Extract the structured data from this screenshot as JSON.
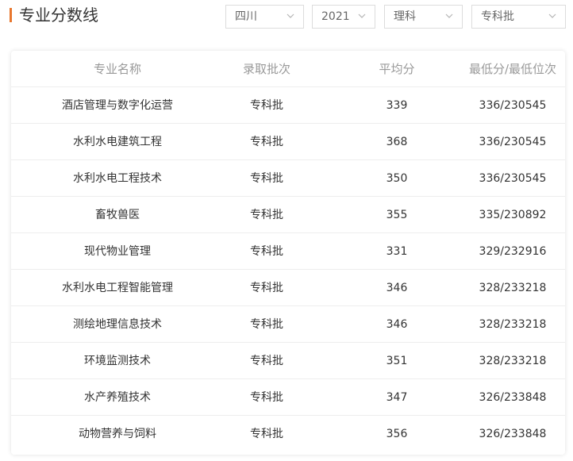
{
  "header": {
    "title": "专业分数线",
    "accent_color": "#e8772e"
  },
  "filters": {
    "province": "四川",
    "year": "2021",
    "subject": "理科",
    "batch": "专科批",
    "chevron_icon": "chevron-down-icon"
  },
  "table": {
    "columns": [
      "专业名称",
      "录取批次",
      "平均分",
      "最低分/最低位次"
    ],
    "rows": [
      {
        "major": "酒店管理与数字化运营",
        "batch": "专科批",
        "avg": "339",
        "min": "336/230545"
      },
      {
        "major": "水利水电建筑工程",
        "batch": "专科批",
        "avg": "368",
        "min": "336/230545"
      },
      {
        "major": "水利水电工程技术",
        "batch": "专科批",
        "avg": "350",
        "min": "336/230545"
      },
      {
        "major": "畜牧兽医",
        "batch": "专科批",
        "avg": "355",
        "min": "335/230892"
      },
      {
        "major": "现代物业管理",
        "batch": "专科批",
        "avg": "331",
        "min": "329/232916"
      },
      {
        "major": "水利水电工程智能管理",
        "batch": "专科批",
        "avg": "346",
        "min": "328/233218"
      },
      {
        "major": "测绘地理信息技术",
        "batch": "专科批",
        "avg": "346",
        "min": "328/233218"
      },
      {
        "major": "环境监测技术",
        "batch": "专科批",
        "avg": "351",
        "min": "328/233218"
      },
      {
        "major": "水产养殖技术",
        "batch": "专科批",
        "avg": "347",
        "min": "326/233848"
      },
      {
        "major": "动物营养与饲料",
        "batch": "专科批",
        "avg": "356",
        "min": "326/233848"
      }
    ]
  }
}
